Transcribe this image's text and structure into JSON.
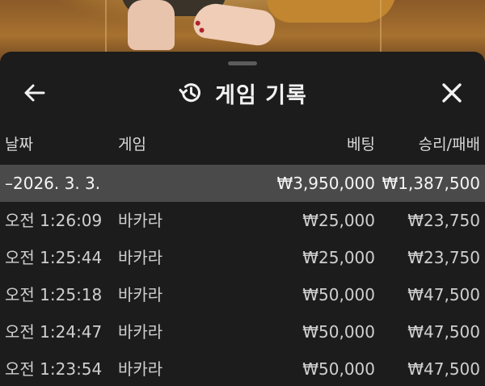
{
  "header": {
    "title": "게임 기록",
    "back_icon": "back-arrow-icon",
    "history_icon": "history-clock-icon",
    "close_icon": "close-icon"
  },
  "columns": {
    "date": "날짜",
    "game": "게임",
    "bet": "베팅",
    "result": "승리/패배"
  },
  "summary": {
    "date": "–2026. 3. 3.",
    "bet": "₩3,950,000",
    "result": "₩1,387,500"
  },
  "rows": [
    {
      "time": "오전 1:26:09",
      "game": "바카라",
      "bet": "₩25,000",
      "result": "₩23,750"
    },
    {
      "time": "오전 1:25:44",
      "game": "바카라",
      "bet": "₩25,000",
      "result": "₩23,750"
    },
    {
      "time": "오전 1:25:18",
      "game": "바카라",
      "bet": "₩50,000",
      "result": "₩47,500"
    },
    {
      "time": "오전 1:24:47",
      "game": "바카라",
      "bet": "₩50,000",
      "result": "₩47,500"
    },
    {
      "time": "오전 1:23:54",
      "game": "바카라",
      "bet": "₩50,000",
      "result": "₩47,500"
    }
  ],
  "colors": {
    "sheet_bg": "#1c1c1c",
    "summary_bg": "#4a4a4a",
    "text_primary": "#f2f2f2",
    "text_secondary": "#cfcfcf"
  }
}
